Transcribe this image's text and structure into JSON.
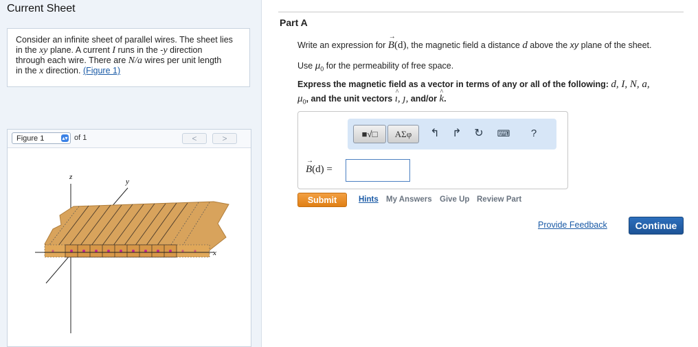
{
  "sheet": {
    "title": "Current Sheet"
  },
  "problem": {
    "t1": "Consider an infinite sheet of parallel wires. The sheet lies",
    "t2a": "in the ",
    "t2b": "xy",
    "t2c": " plane. A current ",
    "t2d": "I",
    "t2e": " runs in the -",
    "t2f": "y",
    "t2g": " direction",
    "t3a": "through each wire. There are ",
    "t3b": "N/a",
    "t3c": " wires per unit length",
    "t4a": "in the ",
    "t4b": "x",
    "t4c": " direction. ",
    "t4link": "(Figure 1)"
  },
  "figure": {
    "selector": "Figure 1",
    "of": "of 1",
    "prev": "<",
    "next": ">",
    "axis_z": "z",
    "axis_y": "y",
    "axis_x": "x"
  },
  "part": {
    "title": "Part A",
    "q1a": "Write an expression for ",
    "q1b": "B",
    "q1c": "(d)",
    "q1d": ", the magnetic field a distance ",
    "q1e": "d",
    "q1f": " above the ",
    "q1g": "xy",
    "q1h": " plane of the sheet.",
    "q2a": "Use ",
    "q2b": "μ",
    "q2c": "0",
    "q2d": " for the permeability of free space.",
    "q3a": "Express the magnetic field as a vector in terms of any or all of the following: ",
    "q3b": "d, I, N, a,",
    "q4a": "μ",
    "q4b": "0",
    "q4c": ", and the unit vectors ",
    "q4d": "ı, ȷ,",
    "q4e": " and/or ",
    "q4f": "k",
    "q4g": "."
  },
  "toolbar": {
    "templates_label": "■√□",
    "greek_label": "ΑΣφ",
    "help_label": "?"
  },
  "answer": {
    "label_b": "B",
    "label_rest": "(d) ="
  },
  "actions": {
    "submit": "Submit",
    "hints": "Hints",
    "my_answers": "My Answers",
    "give_up": "Give Up",
    "review_part": "Review Part",
    "feedback": "Provide Feedback",
    "continue": "Continue"
  }
}
